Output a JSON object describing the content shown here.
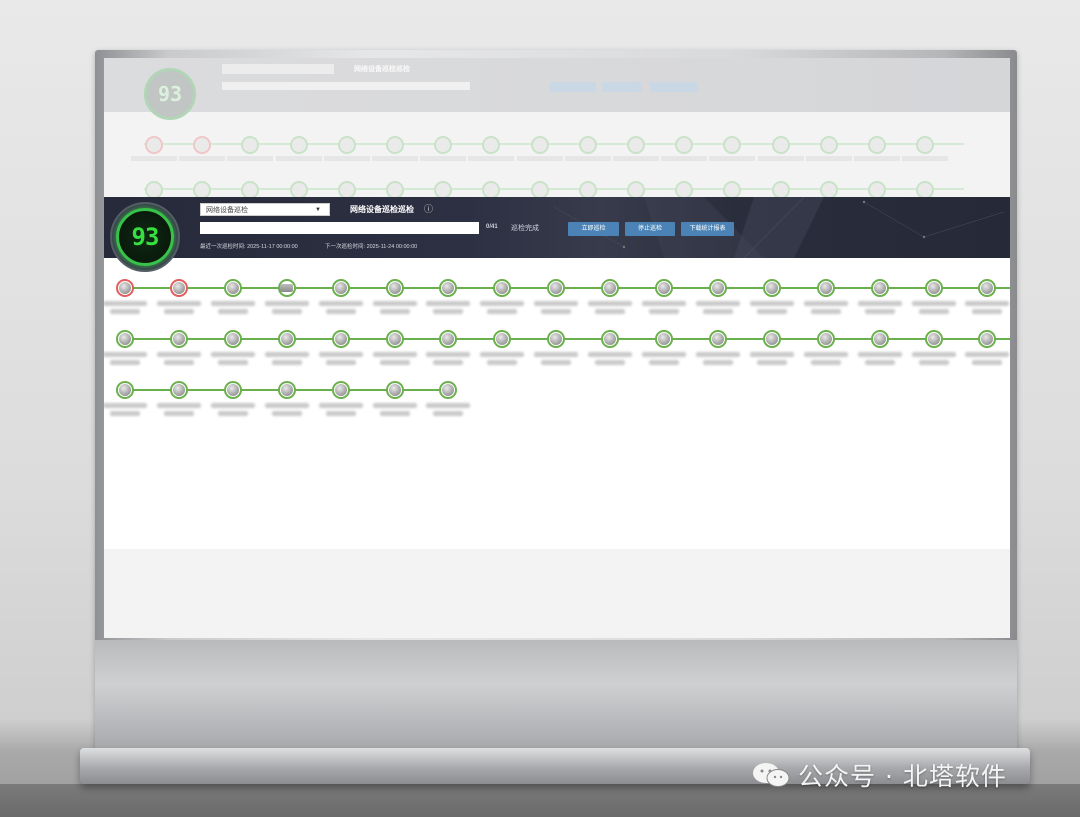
{
  "app": {
    "score": "93",
    "dropdown": {
      "selected": "网络设备巡检"
    },
    "title": "网络设备巡检巡检",
    "info_icon": "ⓘ",
    "progress": {
      "count": "0/41",
      "status": "巡检完成"
    },
    "buttons": {
      "inspect_now": "立即巡检",
      "stop": "停止巡检",
      "download_report": "下载统计报表"
    },
    "last_inspection": {
      "label": "最近一次巡检时间:",
      "value": "2025-11-17 00:00:00"
    },
    "next_inspection": {
      "label": "下一次巡检时间:",
      "value": "2025-11-24 00:00:00"
    },
    "device_rows": [
      {
        "row": 1,
        "nodes": [
          {
            "status": "error",
            "icon": "device-icon"
          },
          {
            "status": "error",
            "icon": "device-icon"
          },
          {
            "status": "ok",
            "icon": "device-icon"
          },
          {
            "status": "ok",
            "icon": "switch-icon"
          },
          {
            "status": "ok",
            "icon": "device-icon"
          },
          {
            "status": "ok",
            "icon": "device-icon"
          },
          {
            "status": "ok",
            "icon": "device-icon"
          },
          {
            "status": "ok",
            "icon": "device-icon"
          },
          {
            "status": "ok",
            "icon": "device-icon"
          },
          {
            "status": "ok",
            "icon": "device-icon"
          },
          {
            "status": "ok",
            "icon": "device-icon"
          },
          {
            "status": "ok",
            "icon": "device-icon"
          },
          {
            "status": "ok",
            "icon": "device-icon"
          },
          {
            "status": "ok",
            "icon": "device-icon"
          },
          {
            "status": "ok",
            "icon": "device-icon"
          },
          {
            "status": "ok",
            "icon": "device-icon"
          },
          {
            "status": "ok",
            "icon": "device-icon"
          }
        ]
      },
      {
        "row": 2,
        "nodes": [
          {
            "status": "ok",
            "icon": "device-icon"
          },
          {
            "status": "ok",
            "icon": "device-icon"
          },
          {
            "status": "ok",
            "icon": "device-icon"
          },
          {
            "status": "ok",
            "icon": "device-icon"
          },
          {
            "status": "ok",
            "icon": "device-icon"
          },
          {
            "status": "ok",
            "icon": "device-icon"
          },
          {
            "status": "ok",
            "icon": "device-icon"
          },
          {
            "status": "ok",
            "icon": "device-icon"
          },
          {
            "status": "ok",
            "icon": "device-icon"
          },
          {
            "status": "ok",
            "icon": "device-icon"
          },
          {
            "status": "ok",
            "icon": "device-icon"
          },
          {
            "status": "ok",
            "icon": "device-icon"
          },
          {
            "status": "ok",
            "icon": "device-icon"
          },
          {
            "status": "ok",
            "icon": "device-icon"
          },
          {
            "status": "ok",
            "icon": "device-icon"
          },
          {
            "status": "ok",
            "icon": "device-icon"
          },
          {
            "status": "ok",
            "icon": "device-icon"
          }
        ]
      },
      {
        "row": 3,
        "nodes": [
          {
            "status": "ok",
            "icon": "device-icon"
          },
          {
            "status": "ok",
            "icon": "device-icon"
          },
          {
            "status": "ok",
            "icon": "device-icon"
          },
          {
            "status": "ok",
            "icon": "device-icon"
          },
          {
            "status": "ok",
            "icon": "device-icon"
          },
          {
            "status": "ok",
            "icon": "device-icon"
          },
          {
            "status": "ok",
            "icon": "device-icon"
          }
        ]
      }
    ],
    "colors": {
      "header_bg": "#262a3a",
      "ok": "#6ab04c",
      "error": "#e35d5d",
      "score": "#35e040",
      "button": "#4c83b6"
    }
  },
  "watermark": {
    "text": "公众号 · 北塔软件",
    "icon": "wechat-icon"
  }
}
